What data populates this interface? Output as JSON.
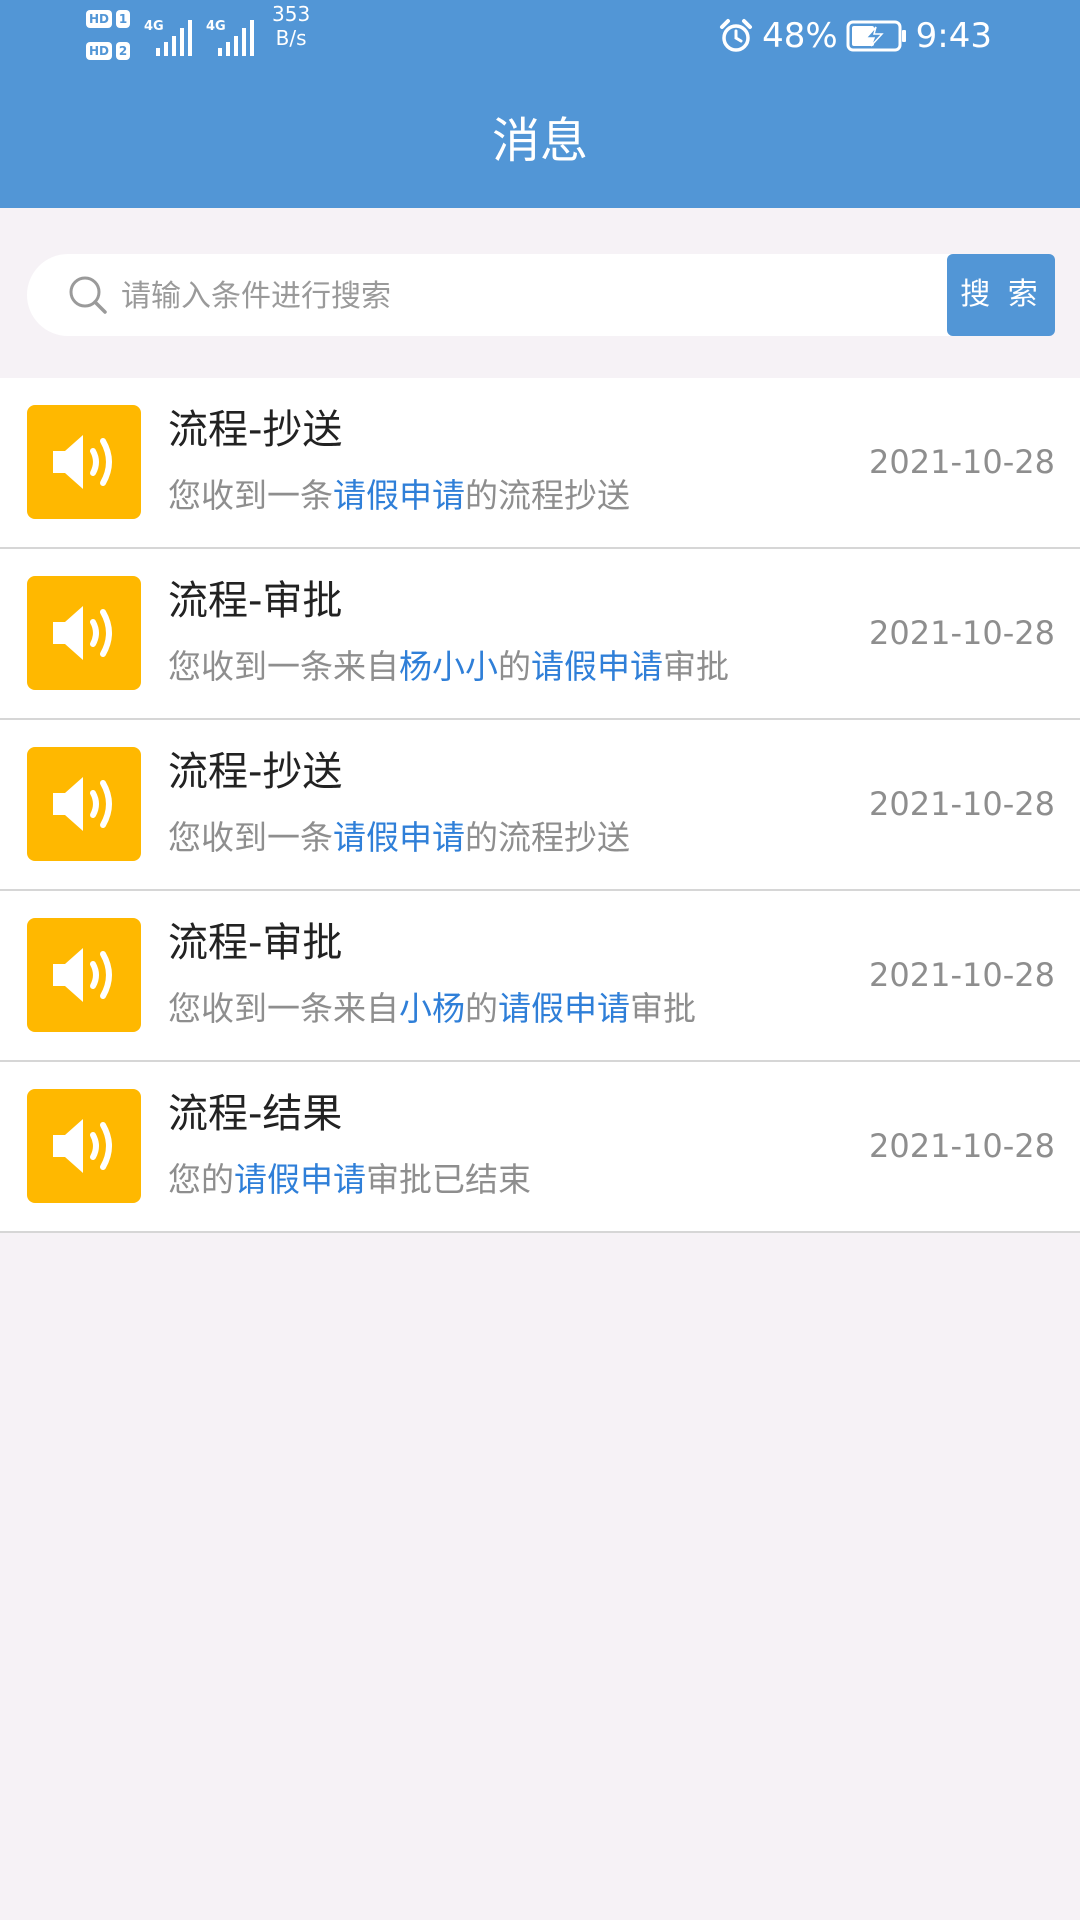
{
  "status_bar": {
    "sim1_label": "HD",
    "sim1_num": "1",
    "sim2_label": "HD",
    "sim2_num": "2",
    "network1": "4G",
    "network2": "4G",
    "net_speed_value": "353",
    "net_speed_unit": "B/s",
    "battery": "48%",
    "time": "9:43"
  },
  "header": {
    "title": "消息"
  },
  "search": {
    "placeholder": "请输入条件进行搜索",
    "value": "",
    "button_label": "搜 索"
  },
  "colors": {
    "header_bg": "#5296d6",
    "icon_bg": "#ffb800",
    "highlight": "#2f7fd8",
    "page_bg": "#f6f2f6"
  },
  "messages": [
    {
      "title": "流程-抄送",
      "desc": [
        {
          "t": "您收到一条",
          "hl": false
        },
        {
          "t": "请假申请",
          "hl": true
        },
        {
          "t": "的流程抄送",
          "hl": false
        }
      ],
      "date": "2021-10-28",
      "icon": "speaker-icon"
    },
    {
      "title": "流程-审批",
      "desc": [
        {
          "t": "您收到一条来自",
          "hl": false
        },
        {
          "t": "杨小小",
          "hl": true
        },
        {
          "t": "的",
          "hl": false
        },
        {
          "t": "请假申请",
          "hl": true
        },
        {
          "t": "审批",
          "hl": false
        }
      ],
      "date": "2021-10-28",
      "icon": "speaker-icon"
    },
    {
      "title": "流程-抄送",
      "desc": [
        {
          "t": "您收到一条",
          "hl": false
        },
        {
          "t": "请假申请",
          "hl": true
        },
        {
          "t": "的流程抄送",
          "hl": false
        }
      ],
      "date": "2021-10-28",
      "icon": "speaker-icon"
    },
    {
      "title": "流程-审批",
      "desc": [
        {
          "t": "您收到一条来自",
          "hl": false
        },
        {
          "t": "小杨",
          "hl": true
        },
        {
          "t": "的",
          "hl": false
        },
        {
          "t": "请假申请",
          "hl": true
        },
        {
          "t": "审批",
          "hl": false
        }
      ],
      "date": "2021-10-28",
      "icon": "speaker-icon"
    },
    {
      "title": "流程-结果",
      "desc": [
        {
          "t": "您的",
          "hl": false
        },
        {
          "t": "请假申请",
          "hl": true
        },
        {
          "t": "审批已结束",
          "hl": false
        }
      ],
      "date": "2021-10-28",
      "icon": "speaker-icon"
    }
  ]
}
